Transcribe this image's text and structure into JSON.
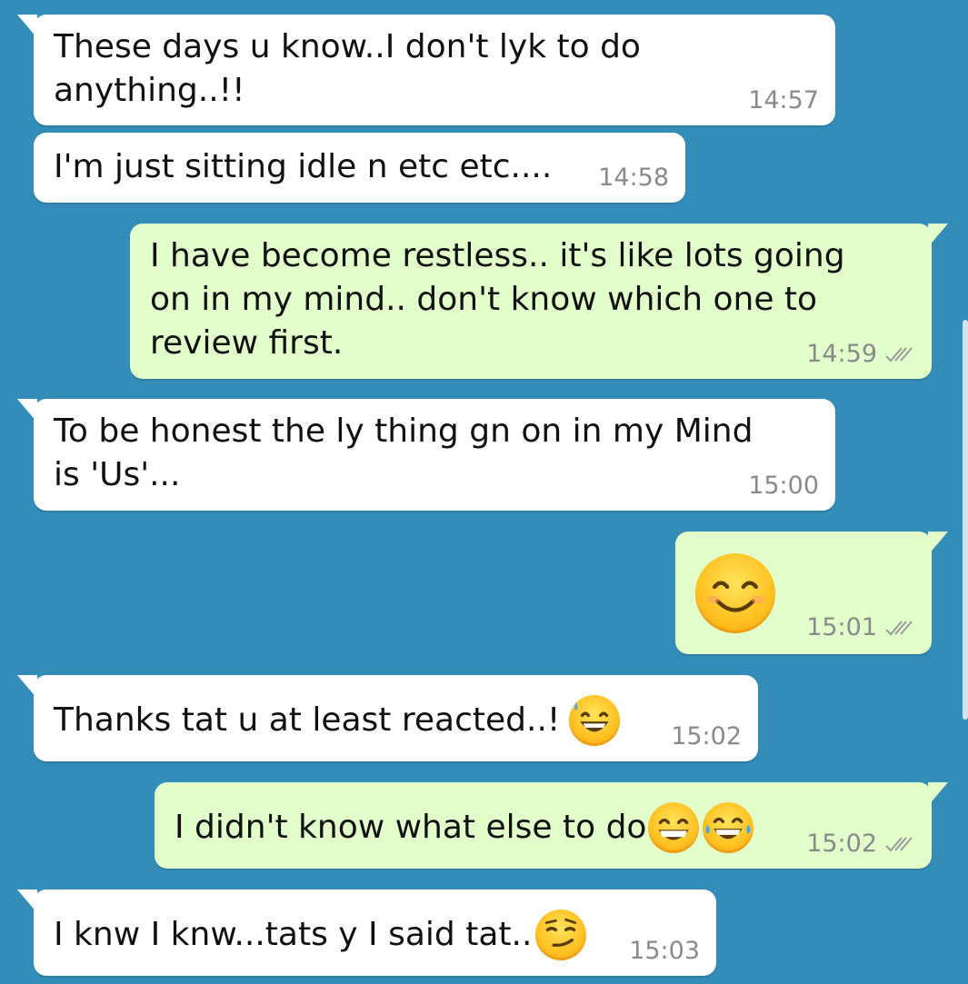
{
  "colors": {
    "background": "#338db8",
    "incoming_bubble": "#ffffff",
    "outgoing_bubble": "#e2fecb",
    "timestamp": "#8a8a8a"
  },
  "messages": [
    {
      "direction": "incoming",
      "text": "These days u know..I don't lyk to do\nanything..!!",
      "time": "14:57"
    },
    {
      "direction": "incoming",
      "text": "I'm just sitting idle n etc etc....",
      "time": "14:58"
    },
    {
      "direction": "outgoing",
      "text": "I have become restless.. it's like lots going\non in my mind.. don't know which one to\nreview first.",
      "time": "14:59",
      "status_icon": "double-check-icon"
    },
    {
      "direction": "incoming",
      "text": "To be honest the ly thing gn on in my Mind\nis 'Us'...",
      "time": "15:00"
    },
    {
      "direction": "outgoing",
      "text": "",
      "time": "15:01",
      "status_icon": "double-check-icon",
      "emoji": [
        "smiling-face-with-smiling-eyes-icon"
      ]
    },
    {
      "direction": "incoming",
      "text": "Thanks tat u at least reacted..!",
      "time": "15:02",
      "emoji": [
        "grinning-face-with-sweat-icon"
      ]
    },
    {
      "direction": "outgoing",
      "text": "I didn't know what else to do",
      "time": "15:02",
      "status_icon": "double-check-icon",
      "emoji": [
        "grinning-face-with-smiling-eyes-icon",
        "face-with-tears-of-joy-icon"
      ]
    },
    {
      "direction": "incoming",
      "text": "I knw I knw...tats y I said tat..",
      "time": "15:03",
      "emoji": [
        "smirking-face-icon"
      ]
    }
  ]
}
